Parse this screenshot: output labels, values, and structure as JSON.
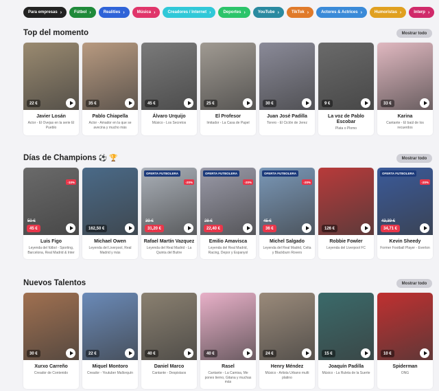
{
  "categories": [
    {
      "label": "Para empresas",
      "color": "#222222"
    },
    {
      "label": "Fútbol",
      "color": "#1f8a3a"
    },
    {
      "label": "Realities",
      "color": "#2f63d8"
    },
    {
      "label": "Música",
      "color": "#e0356a"
    },
    {
      "label": "Creadores / Internet",
      "color": "#30c8d8"
    },
    {
      "label": "Deportes",
      "color": "#2cc46a"
    },
    {
      "label": "YouTube",
      "color": "#2a8aa0"
    },
    {
      "label": "TikTok",
      "color": "#e07a2a"
    },
    {
      "label": "Actores & Actrices",
      "color": "#3a8ad8"
    },
    {
      "label": "Humoristas",
      "color": "#e0a020"
    },
    {
      "label": "Interp",
      "color": "#d02a6a"
    }
  ],
  "show_all_label": "Mostrar todo",
  "offer_label": "OFERTA FUTBOLERA",
  "sections": [
    {
      "title": "Top del momento",
      "emoji": "",
      "cards": [
        {
          "name": "Javier Losán",
          "desc": "Actor - El Ovejas en la serie El Pueblo",
          "price": "22 €",
          "photo": "#9a8a70",
          "red": false
        },
        {
          "name": "Pablo Chiapella",
          "desc": "Actor - Amador en la que se avecina y mucho más",
          "price": "35 €",
          "photo": "#b89a80",
          "red": false
        },
        {
          "name": "Álvaro Urquijo",
          "desc": "Músico - Los Secretos",
          "price": "45 €",
          "photo": "#7a7a7a",
          "red": false
        },
        {
          "name": "El Profesor",
          "desc": "Imitador - La Casa de Papel",
          "price": "25 €",
          "photo": "#a09a92",
          "red": false
        },
        {
          "name": "Juan José Padilla",
          "desc": "Torero - El Ciclón de Jerez",
          "price": "30 €",
          "photo": "#8a8a98",
          "red": false
        },
        {
          "name": "La voz de Pablo Escobar",
          "desc": "Plata o Plomo",
          "price": "9 €",
          "photo": "#6a6a6a",
          "red": false
        },
        {
          "name": "Karina",
          "desc": "Cantante - El baúl de los recuerdos",
          "price": "33 €",
          "photo": "#e0b8c0",
          "red": false
        }
      ]
    },
    {
      "title": "Días de Champions",
      "emoji": "⚽ 🏆",
      "cards": [
        {
          "name": "Luis Figo",
          "desc": "Leyenda del fútbol - Sporting, Barcelona, Real Madrid & Inter",
          "price": "45 €",
          "old": "50 €",
          "disc": "-10%",
          "offer": false,
          "photo": "#6a6a6a",
          "red": true
        },
        {
          "name": "Michael Owen",
          "desc": "Leyenda del Liverpool, Real Madrid y más",
          "price": "162,50 €",
          "offer": false,
          "photo": "#4a6a88",
          "red": false
        },
        {
          "name": "Rafael Martín Vazquez",
          "desc": "Leyenda del Real Madrid - La Quinta del Buitre",
          "price": "31,20 €",
          "old": "39 €",
          "disc": "-20%",
          "offer": true,
          "photo": "#aab0b8",
          "red": true
        },
        {
          "name": "Emilio Amavisca",
          "desc": "Leyenda del Real Madrid, Racing, Depor y Espanyol",
          "price": "22,40 €",
          "old": "28 €",
          "disc": "-20%",
          "offer": true,
          "photo": "#9a9aa8",
          "red": true
        },
        {
          "name": "Michel Salgado",
          "desc": "Leyenda del Real Madrid, Celta y Blackburn Rovers",
          "price": "36 €",
          "old": "45 €",
          "disc": "-20%",
          "offer": true,
          "photo": "#7a98b8",
          "red": true
        },
        {
          "name": "Robbie Fowler",
          "desc": "Leyenda del Liverpool FC",
          "price": "126 €",
          "offer": false,
          "photo": "#b83a3a",
          "red": false
        },
        {
          "name": "Kevin Sheedy",
          "desc": "Former Football Player - Everton",
          "price": "34,71 €",
          "old": "43,39 €",
          "disc": "-20%",
          "offer": true,
          "photo": "#3a5a9a",
          "red": true
        }
      ]
    },
    {
      "title": "Nuevos Talentos",
      "emoji": "",
      "cards": [
        {
          "name": "Xurxo Carreño",
          "desc": "Creador de Contenido",
          "price": "30 €",
          "photo": "#a07050",
          "red": false
        },
        {
          "name": "Miquel Montoro",
          "desc": "Creador - Youtuber Mallorquín",
          "price": "22 €",
          "photo": "#6a8ab8",
          "red": false
        },
        {
          "name": "Daniel Marco",
          "desc": "Cantante - Despistaos",
          "price": "40 €",
          "photo": "#8a8070",
          "red": false
        },
        {
          "name": "Rasel",
          "desc": "Cantante - La Camisa, Me pones tierno, Gitana y muchas más",
          "price": "40 €",
          "photo": "#e8b0c8",
          "red": false
        },
        {
          "name": "Henry Méndez",
          "desc": "Músico - Artista Urbano multi platino",
          "price": "24 €",
          "photo": "#9a8a7a",
          "red": false
        },
        {
          "name": "Joaquín Padilla",
          "desc": "Músico - La Ruleta de la Suerte",
          "price": "15 €",
          "photo": "#3a6a6a",
          "red": false
        },
        {
          "name": "Spiderman",
          "desc": "ONG",
          "price": "10 €",
          "photo": "#c03030",
          "red": false
        }
      ]
    }
  ]
}
